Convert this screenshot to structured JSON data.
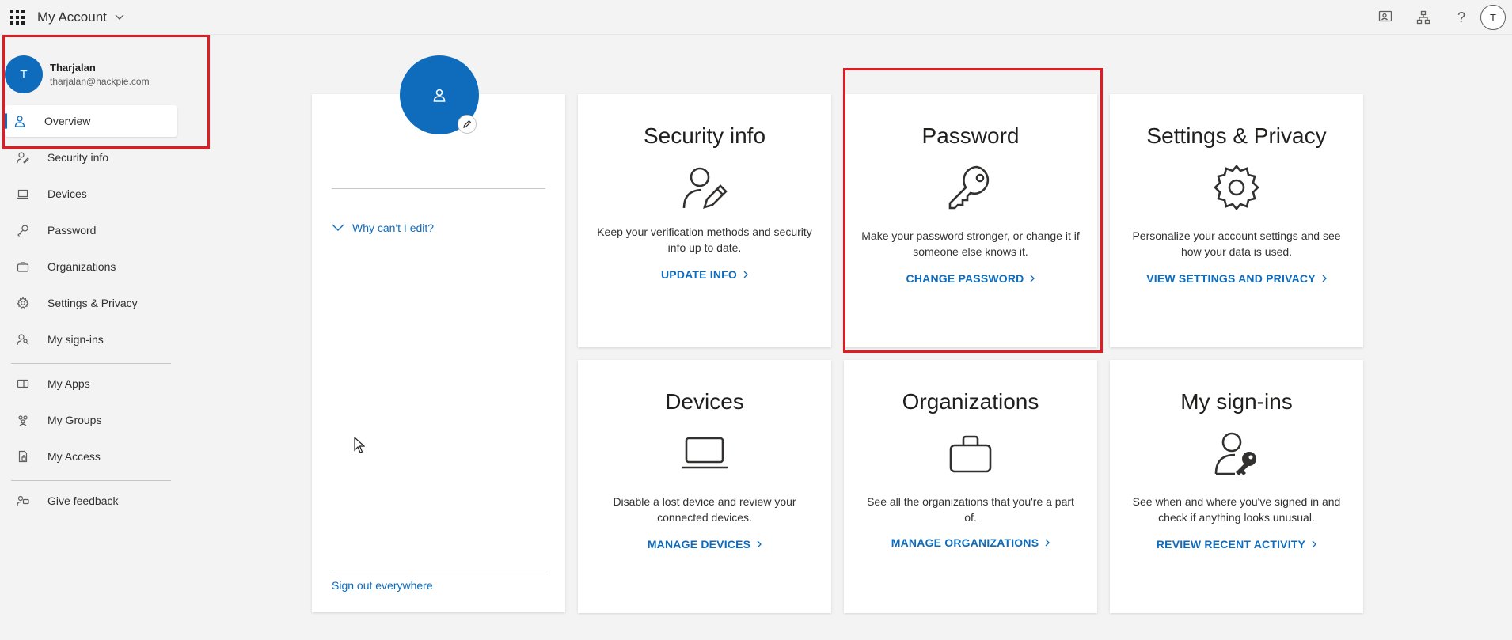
{
  "topbar": {
    "app_title": "My Account",
    "avatar_initial": "T"
  },
  "user": {
    "initial": "T",
    "name": "Tharjalan",
    "email": "tharjalan@hackpie.com"
  },
  "nav": {
    "items": [
      {
        "label": "Overview",
        "icon": "person-icon"
      },
      {
        "label": "Security info",
        "icon": "person-key-icon"
      },
      {
        "label": "Devices",
        "icon": "laptop-icon"
      },
      {
        "label": "Password",
        "icon": "key-icon"
      },
      {
        "label": "Organizations",
        "icon": "briefcase-icon"
      },
      {
        "label": "Settings & Privacy",
        "icon": "gear-icon"
      },
      {
        "label": "My sign-ins",
        "icon": "person-signin-icon"
      },
      {
        "label": "My Apps",
        "icon": "apps-icon"
      },
      {
        "label": "My Groups",
        "icon": "groups-icon"
      },
      {
        "label": "My Access",
        "icon": "access-icon"
      },
      {
        "label": "Give feedback",
        "icon": "feedback-icon"
      }
    ]
  },
  "profile": {
    "why_edit": "Why can't I edit?",
    "sign_out": "Sign out everywhere"
  },
  "tiles": [
    {
      "title": "Security info",
      "desc": "Keep your verification methods and security info up to date.",
      "link": "UPDATE INFO"
    },
    {
      "title": "Password",
      "desc": "Make your password stronger, or change it if someone else knows it.",
      "link": "CHANGE PASSWORD"
    },
    {
      "title": "Settings & Privacy",
      "desc": "Personalize your account settings and see how your data is used.",
      "link": "VIEW SETTINGS AND PRIVACY"
    },
    {
      "title": "Devices",
      "desc": "Disable a lost device and review your connected devices.",
      "link": "MANAGE DEVICES"
    },
    {
      "title": "Organizations",
      "desc": "See all the organizations that you're a part of.",
      "link": "MANAGE ORGANIZATIONS"
    },
    {
      "title": "My sign-ins",
      "desc": "See when and where you've signed in and check if anything looks unusual.",
      "link": "REVIEW RECENT ACTIVITY"
    }
  ],
  "colors": {
    "accent": "#0f6cbd",
    "highlight": "#e11b22"
  }
}
